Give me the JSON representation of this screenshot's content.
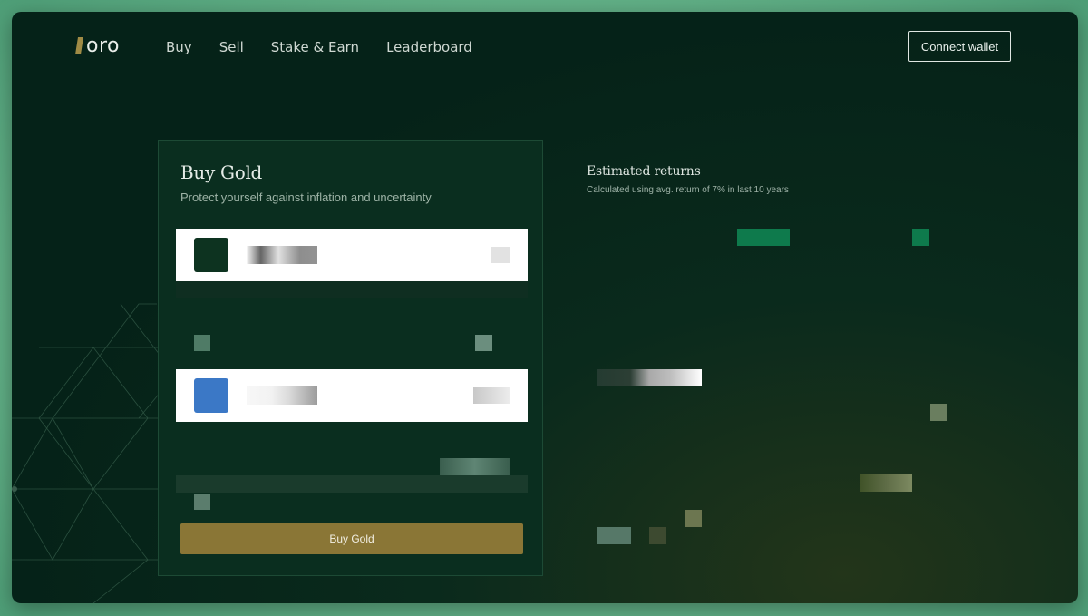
{
  "brand": {
    "name": "oro",
    "accent": "#a08b45"
  },
  "nav": {
    "items": [
      {
        "label": "Buy"
      },
      {
        "label": "Sell"
      },
      {
        "label": "Stake & Earn"
      },
      {
        "label": "Leaderboard"
      }
    ]
  },
  "header": {
    "connect_label": "Connect wallet"
  },
  "buy_card": {
    "title": "Buy Gold",
    "subtitle": "Protect yourself against inflation and uncertainty",
    "pay_field": {
      "token_color": "#0d3320",
      "placeholder": ""
    },
    "receive_field": {
      "token_color": "#3b78c6",
      "placeholder": ""
    },
    "button_label": "Buy Gold",
    "button_color": "#8a7636"
  },
  "returns": {
    "title": "Estimated returns",
    "subtitle": "Calculated using avg. return of 7% in last 10 years",
    "accent": "#0e7a4c"
  }
}
